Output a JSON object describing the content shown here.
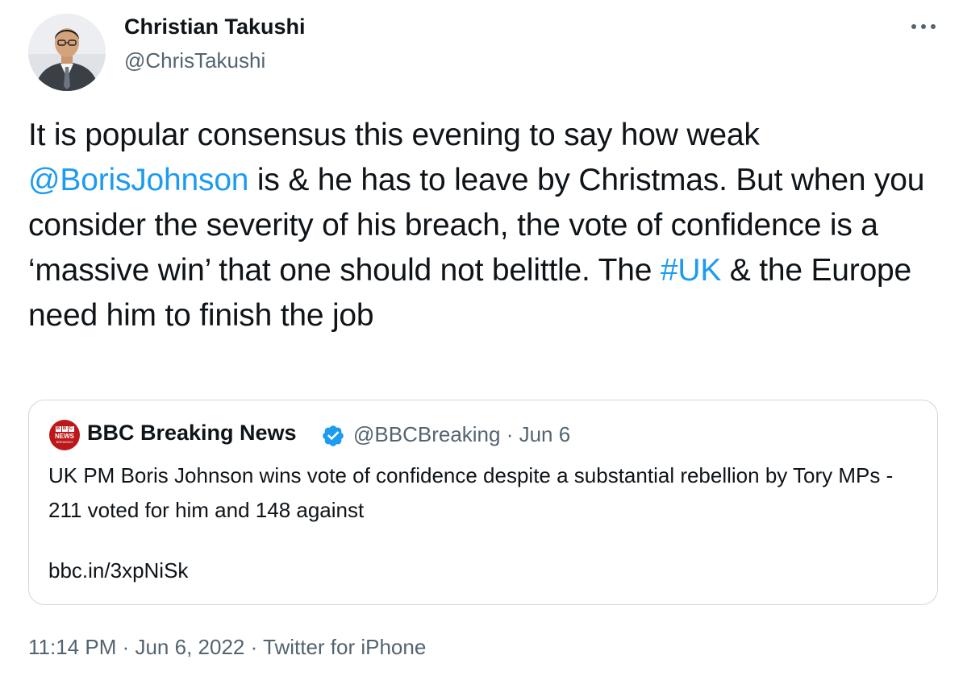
{
  "author": {
    "name": "Christian Takushi",
    "handle": "@ChrisTakushi",
    "avatar_icon": "profile-photo"
  },
  "tweet": {
    "parts": [
      {
        "text": "It is popular consensus this evening to say how weak ",
        "type": "text"
      },
      {
        "text": "@BorisJohnson",
        "type": "mention"
      },
      {
        "text": " is & he has to leave by Christmas. But when you consider the severity of his breach, the vote of confidence is a ‘massive win’ that one should not belittle. The ",
        "type": "text"
      },
      {
        "text": "#UK",
        "type": "hashtag"
      },
      {
        "text": " & the Europe need him to finish the job",
        "type": "text"
      }
    ]
  },
  "quote": {
    "logo_top": "BBC",
    "logo_middle": "NEWS",
    "logo_bottom": "BREAKING",
    "name": "BBC Breaking News",
    "handle": "@BBCBreaking · Jun 6",
    "text": "UK PM Boris Johnson wins vote of confidence despite a substantial rebellion by Tory MPs - 211 voted for him and 148 against",
    "link": "bbc.in/3xpNiSk"
  },
  "meta": {
    "time": "11:14 PM",
    "sep1": " · ",
    "date": "Jun 6, 2022",
    "sep2": " · ",
    "source": "Twitter for iPhone"
  },
  "colors": {
    "link": "#1d9bf0",
    "secondary": "#536471",
    "border": "#cfd9de",
    "verified": "#1d9bf0",
    "bbc_red": "#bb1919"
  }
}
